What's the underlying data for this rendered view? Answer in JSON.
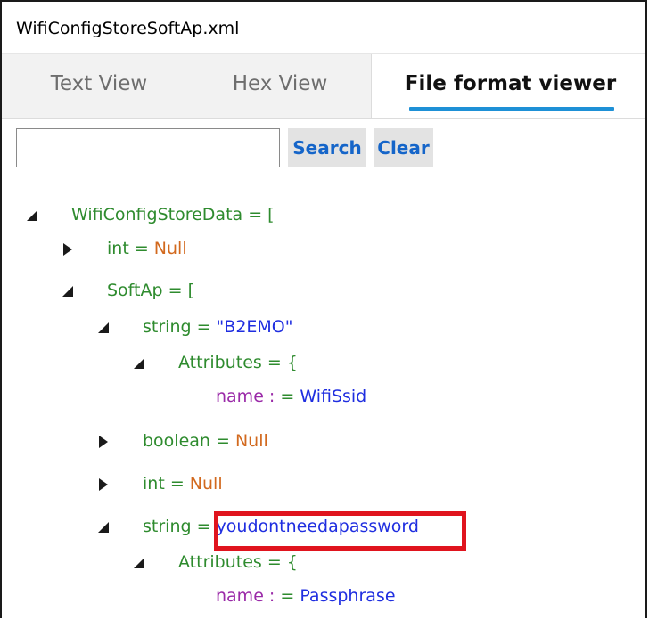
{
  "window": {
    "title": "WifiConfigStoreSoftAp.xml"
  },
  "tabs": [
    {
      "label": "Text View"
    },
    {
      "label": "Hex View"
    },
    {
      "label": "File format viewer"
    }
  ],
  "search": {
    "placeholder": "",
    "value": "",
    "search_label": "Search",
    "clear_label": "Clear"
  },
  "tree": {
    "r1": {
      "name": "WifiConfigStoreData",
      "eq": " = ",
      "bracket": "["
    },
    "r2": {
      "name": "int",
      "eq": " = ",
      "value": "Null"
    },
    "r3": {
      "name": "SoftAp",
      "eq": " = ",
      "bracket": "["
    },
    "r4": {
      "name": "string",
      "eq": " = ",
      "value": "\"B2EMO\""
    },
    "r5": {
      "name": "Attributes",
      "eq": " = ",
      "bracket": "{"
    },
    "r6": {
      "key": "name :",
      "eq": "  = ",
      "value": "WifiSsid"
    },
    "r7": {
      "name": "boolean",
      "eq": " = ",
      "value": "Null"
    },
    "r8": {
      "name": "int",
      "eq": " = ",
      "value": "Null"
    },
    "r9": {
      "name": "string",
      "eq": " = ",
      "value": "youdontneedapassword"
    },
    "r10": {
      "name": "Attributes",
      "eq": " = ",
      "bracket": "{"
    },
    "r11": {
      "key": "name :",
      "eq": "  = ",
      "value": "Passphrase"
    }
  },
  "colors": {
    "accent": "#1e90d6",
    "highlight": "#e0141e",
    "element_name": "#2e8b2e",
    "null_value": "#d2691e",
    "string_value": "#1f2ee0",
    "attribute_key": "#9a2aa8"
  },
  "icons": {
    "expanded": "expanded-triangle-icon",
    "collapsed": "collapsed-triangle-icon"
  }
}
